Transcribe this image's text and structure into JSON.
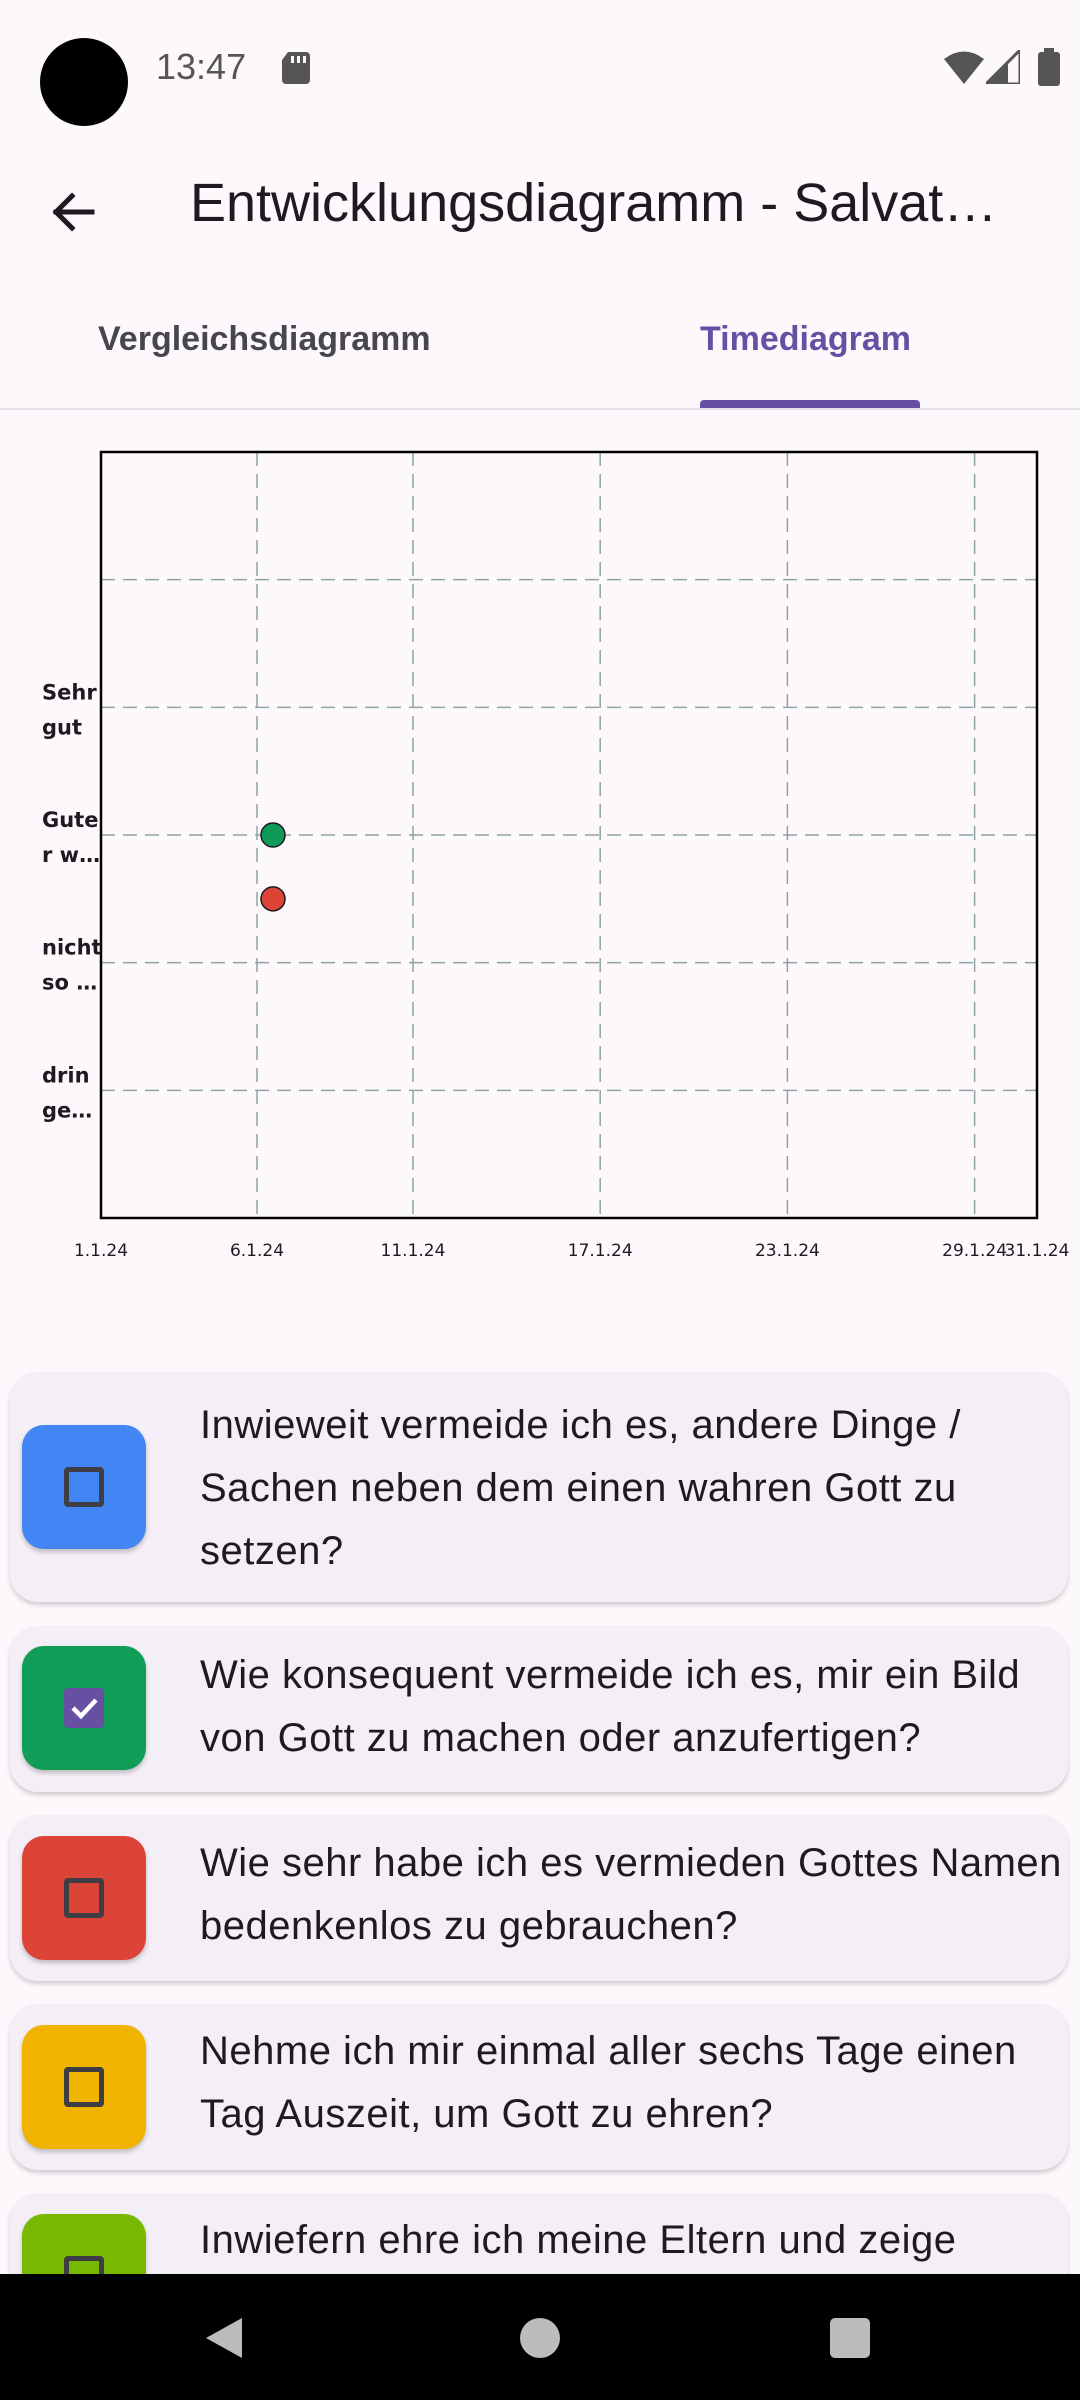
{
  "status_bar": {
    "time": "13:47"
  },
  "app_bar": {
    "title": "Entwicklungsdiagramm - Salvat…"
  },
  "tabs": [
    {
      "label": "Vergleichsdiagramm",
      "selected": false
    },
    {
      "label": "Timediagram",
      "selected": true
    }
  ],
  "chart_data": {
    "type": "scatter",
    "title": "",
    "xlabel": "",
    "ylabel": "",
    "x_ticks": [
      "1.1.24",
      "6.1.24",
      "11.1.24",
      "17.1.24",
      "23.1.24",
      "29.1.24",
      "31.1.24"
    ],
    "y_ticks": [
      "drin ge…",
      "nicht so …",
      "Gute r w…",
      "Sehr gut"
    ],
    "y_tick_lines": [
      {
        "label": "Sehr gut",
        "lines": [
          "Sehr",
          "gut"
        ]
      },
      {
        "label": "Gute r w…",
        "lines": [
          "Gute",
          "r w…"
        ]
      },
      {
        "label": "nicht so …",
        "lines": [
          "nicht",
          "so …"
        ]
      },
      {
        "label": "drin ge…",
        "lines": [
          "drin",
          "ge…"
        ]
      }
    ],
    "xlim": [
      "1.1.24",
      "31.1.24"
    ],
    "ylim": [
      0,
      6
    ],
    "grid": true,
    "series": [
      {
        "color": "#109a57",
        "points": [
          {
            "x": "6.1.24",
            "y": 3
          }
        ]
      },
      {
        "color": "#db4437",
        "points": [
          {
            "x": "6.1.24",
            "y": 2.5
          }
        ]
      }
    ]
  },
  "questions": [
    {
      "text": "Inwieweit vermeide ich es, andere Dinge / Sachen neben dem einen wahren Gott zu setzen?",
      "color": "#4285f4",
      "checked": false
    },
    {
      "text": "Wie konsequent vermeide ich es, mir ein Bild von Gott zu machen oder anzufertigen?",
      "color": "#0f9d58",
      "checked": true
    },
    {
      "text": "Wie sehr habe ich es vermieden Gottes Namen bedenkenlos zu gebrauchen?",
      "color": "#db4437",
      "checked": false
    },
    {
      "text": "Nehme ich mir einmal aller sechs Tage einen Tag Auszeit, um Gott zu ehren?",
      "color": "#f0b400",
      "checked": false
    },
    {
      "text": "Inwiefern ehre ich meine Eltern und zeige",
      "color": "#76b900",
      "checked": false
    }
  ],
  "icons": {
    "back": "arrow-left-icon",
    "sd": "sd-card-icon",
    "wifi": "wifi-icon",
    "cell": "cell-signal-icon",
    "battery": "battery-icon",
    "check": "checkmark-icon"
  }
}
